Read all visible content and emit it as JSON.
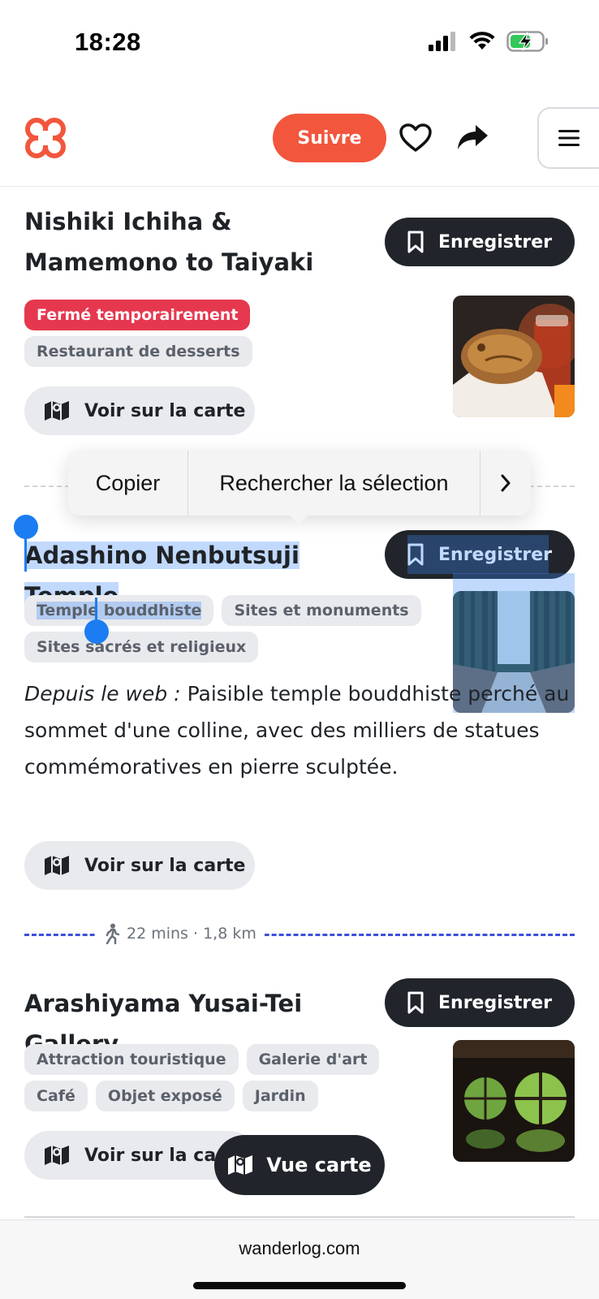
{
  "status": {
    "time": "18:28"
  },
  "header": {
    "follow_label": "Suivre"
  },
  "places": [
    {
      "title": "Nishiki Ichiha & Mamemono to Taiyaki",
      "save_label": "Enregistrer",
      "closed_badge": "Fermé temporairement",
      "tags": [
        "Restaurant de desserts"
      ],
      "map_label": "Voir sur la carte"
    },
    {
      "title": "Adashino Nenbutsuji Temple",
      "save_label": "Enregistrer",
      "tags": [
        "Temple bouddhiste",
        "Sites et monuments",
        "Sites sacrés et religieux"
      ],
      "desc_prefix": "Depuis le web :",
      "desc_text": "Paisible temple bouddhiste perché au sommet d'une colline, avec des milliers de statues commémoratives en pierre sculptée.",
      "map_label": "Voir sur la carte"
    },
    {
      "title": "Arashiyama Yusai-Tei Gallery",
      "save_label": "Enregistrer",
      "tags": [
        "Attraction touristique",
        "Galerie d'art",
        "Café",
        "Objet exposé",
        "Jardin"
      ],
      "map_label": "Voir sur la carte"
    }
  ],
  "walk": {
    "text": "22 mins · 1,8 km"
  },
  "context_menu": {
    "copy": "Copier",
    "lookup": "Rechercher la sélection"
  },
  "map_fab": {
    "label": "Vue carte"
  },
  "browser": {
    "url": "wanderlog.com"
  },
  "colors": {
    "accent": "#f2563d",
    "dark": "#21252b",
    "selection": "#1c7cf2",
    "route": "#3b4fd8"
  }
}
